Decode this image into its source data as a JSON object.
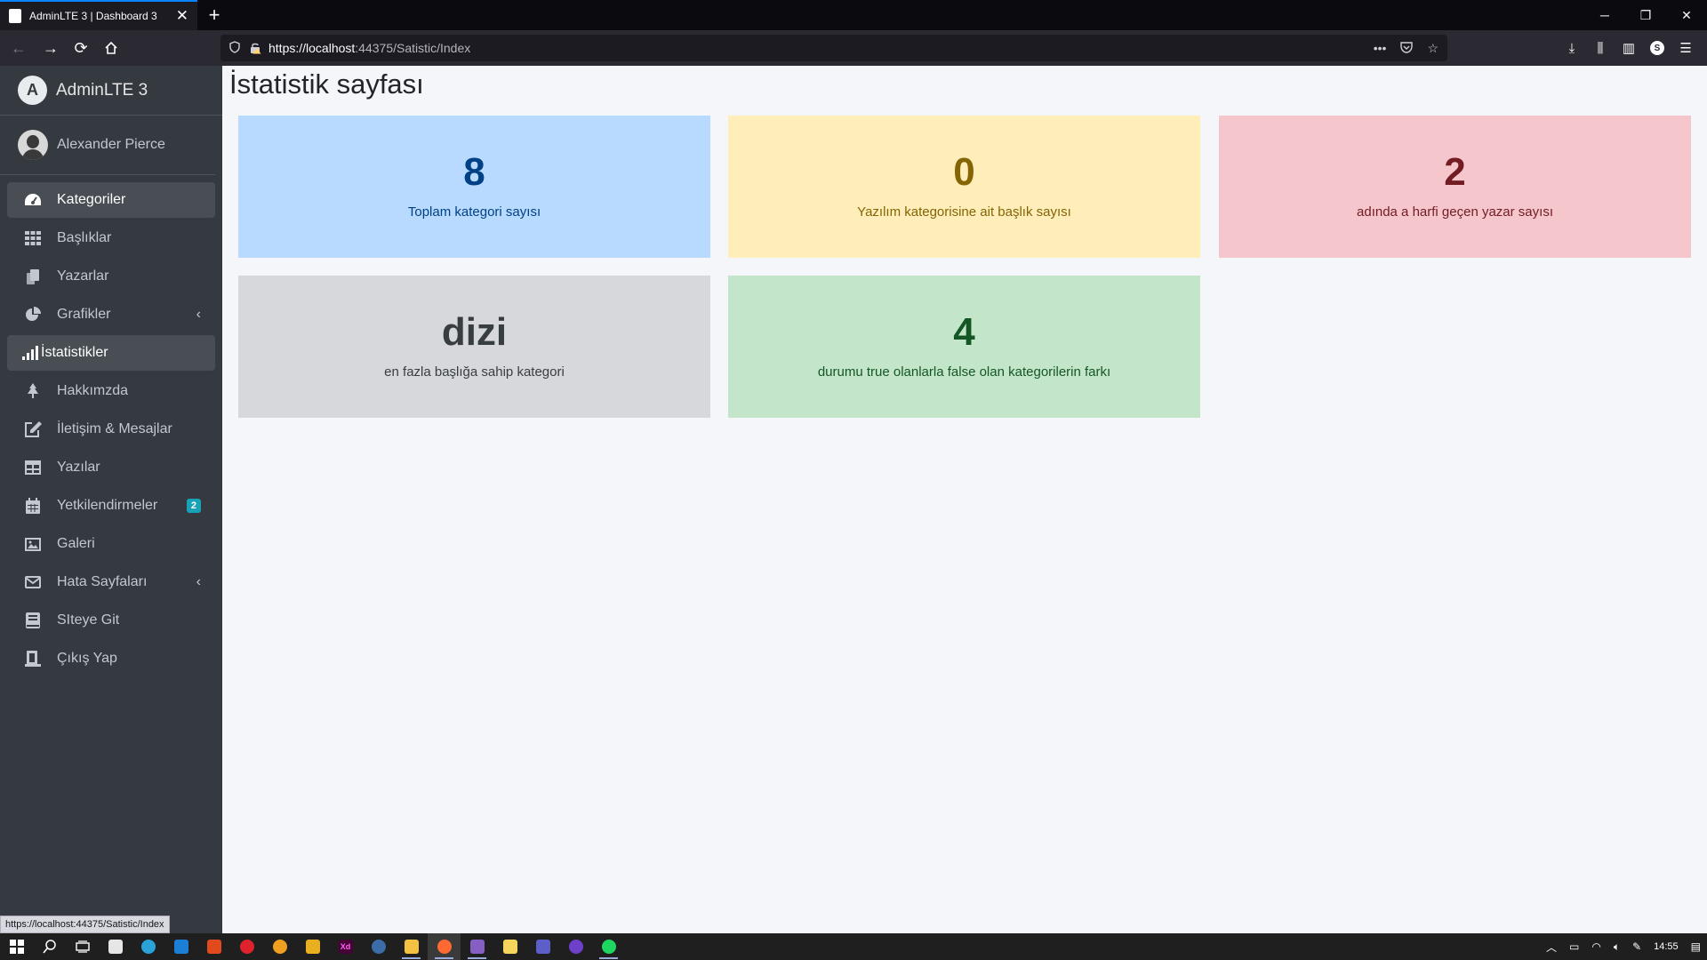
{
  "browser": {
    "tab_title": "AdminLTE 3 | Dashboard 3",
    "url_host": "https://localhost",
    "url_path": ":44375/Satistic/Index",
    "status_url": "https://localhost:44375/Satistic/Index"
  },
  "sidebar": {
    "brand": "AdminLTE 3",
    "user": "Alexander Pierce",
    "items": [
      {
        "label": "Kategoriler",
        "icon": "dashboard-icon"
      },
      {
        "label": "Başlıklar",
        "icon": "grid-icon"
      },
      {
        "label": "Yazarlar",
        "icon": "copy-icon"
      },
      {
        "label": "Grafikler",
        "icon": "pie-chart-icon"
      },
      {
        "label": "İstatistikler",
        "icon": "signal-icon"
      },
      {
        "label": "Hakkımzda",
        "icon": "tree-icon"
      },
      {
        "label": "İletişim & Mesajlar",
        "icon": "edit-icon"
      },
      {
        "label": "Yazılar",
        "icon": "table-icon"
      },
      {
        "label": "Yetkilendirmeler",
        "icon": "calendar-icon",
        "badge": "2"
      },
      {
        "label": "Galeri",
        "icon": "image-icon"
      },
      {
        "label": "Hata Sayfaları",
        "icon": "envelope-icon"
      },
      {
        "label": "SIteye Git",
        "icon": "book-icon"
      },
      {
        "label": "Çıkış Yap",
        "icon": "logout-icon"
      }
    ]
  },
  "main": {
    "title": "İstatistik sayfası",
    "stats": [
      {
        "value": "8",
        "label": "Toplam kategori sayısı",
        "variant": "primary"
      },
      {
        "value": "0",
        "label": "Yazılım kategorisine ait başlık sayısı",
        "variant": "warning"
      },
      {
        "value": "2",
        "label": "adında a harfi geçen yazar sayısı",
        "variant": "danger"
      },
      {
        "value": "dizi",
        "label": "en fazla başlığa sahip kategori",
        "variant": "secondary"
      },
      {
        "value": "4",
        "label": "durumu true olanlarla false olan kategorilerin farkı",
        "variant": "success"
      }
    ]
  },
  "taskbar": {
    "clock": "14:55"
  }
}
